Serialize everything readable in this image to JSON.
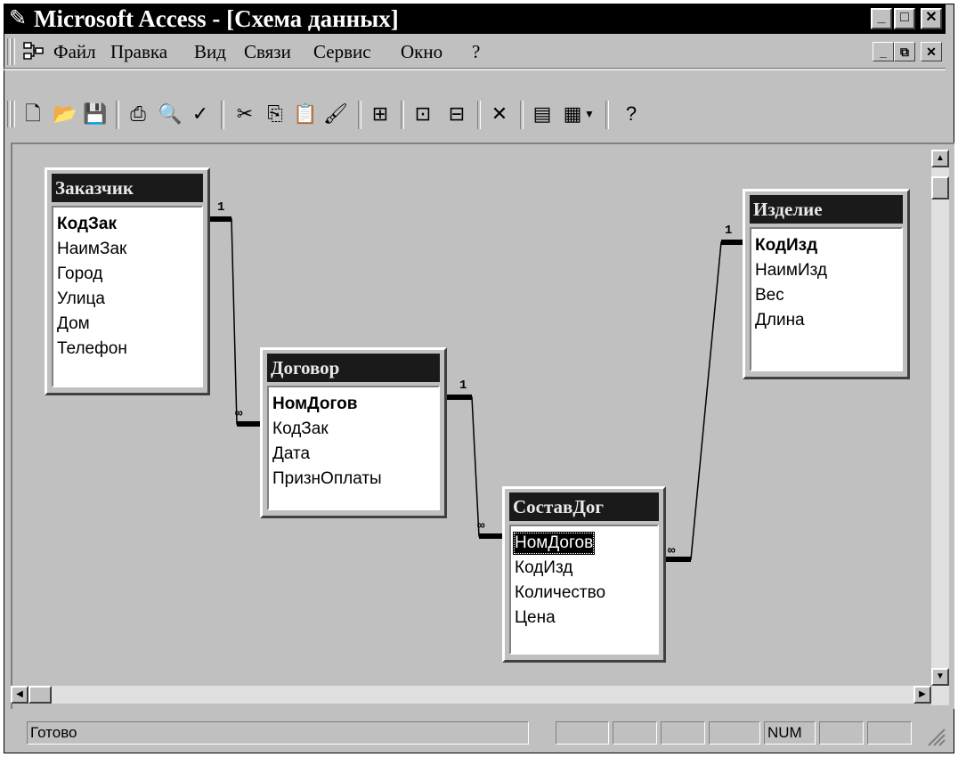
{
  "window": {
    "title": "Microsoft Access - [Схема данных]"
  },
  "menu": {
    "items": [
      "Файл",
      "Правка",
      "Вид",
      "Связи",
      "Сервис",
      "Окно",
      "?"
    ]
  },
  "toolbar": {
    "icons": [
      "new-icon",
      "open-icon",
      "save-icon",
      "print-icon",
      "print-preview-icon",
      "spelling-icon",
      "cut-icon",
      "copy-icon",
      "paste-icon",
      "format-painter-icon",
      "show-table-icon",
      "show-direct-icon",
      "show-all-icon",
      "delete-icon",
      "new-object-icon",
      "new-object-dropdown-icon",
      "help-icon"
    ]
  },
  "tables": [
    {
      "name": "Заказчик",
      "fields": [
        "КодЗак",
        "НаимЗак",
        "Город",
        "Улица",
        "Дом",
        "Телефон"
      ],
      "primary_key": "КодЗак"
    },
    {
      "name": "Договор",
      "fields": [
        "НомДогов",
        "КодЗак",
        "Дата",
        "ПризнОплаты"
      ],
      "primary_key": "НомДогов"
    },
    {
      "name": "СоставДог",
      "fields": [
        "НомДогов",
        "КодИзд",
        "Количество",
        "Цена"
      ],
      "selected_field": "НомДогов"
    },
    {
      "name": "Изделие",
      "fields": [
        "КодИзд",
        "НаимИзд",
        "Вес",
        "Длина"
      ],
      "primary_key": "КодИзд"
    }
  ],
  "relationships": [
    {
      "from": "Заказчик",
      "to": "Договор",
      "one_label": "1",
      "many_label": "∞"
    },
    {
      "from": "Договор",
      "to": "СоставДог",
      "one_label": "1",
      "many_label": "∞"
    },
    {
      "from": "Изделие",
      "to": "СоставДог",
      "one_label": "1",
      "many_label": "∞"
    }
  ],
  "status": {
    "text": "Готово",
    "num_indicator": "NUM"
  }
}
